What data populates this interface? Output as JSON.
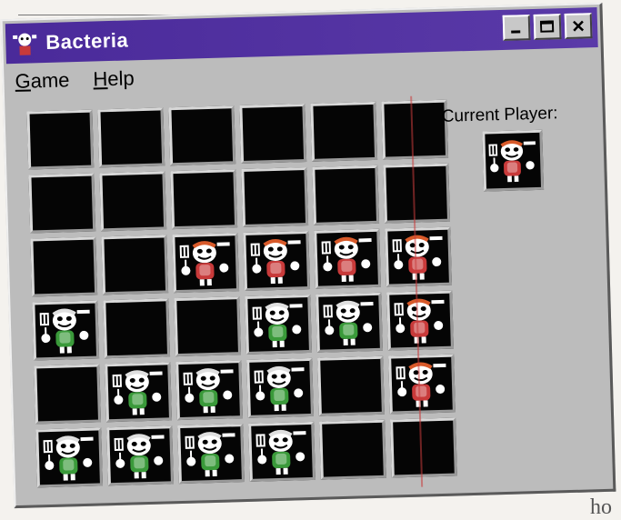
{
  "window": {
    "title": "Bacteria",
    "app_icon": "bacteria-icon",
    "buttons": [
      "minimize",
      "maximize",
      "close"
    ]
  },
  "menu": [
    {
      "label": "Game",
      "mnemonic": "G",
      "rest": "ame"
    },
    {
      "label": "Help",
      "mnemonic": "H",
      "rest": "elp"
    }
  ],
  "status": {
    "label": "Current Player:",
    "current_player": "red"
  },
  "board": {
    "rows": 6,
    "cols": 6,
    "cells": [
      [
        "empty",
        "empty",
        "empty",
        "empty",
        "empty",
        "empty"
      ],
      [
        "empty",
        "empty",
        "empty",
        "empty",
        "empty",
        "empty"
      ],
      [
        "empty",
        "empty",
        "red",
        "red",
        "red",
        "red"
      ],
      [
        "green",
        "empty",
        "empty",
        "green",
        "green",
        "red"
      ],
      [
        "empty",
        "green",
        "green",
        "green",
        "empty",
        "red"
      ],
      [
        "green",
        "green",
        "green",
        "green",
        "empty",
        "empty"
      ]
    ]
  },
  "colors": {
    "titlebar": "#4a2a9a",
    "red_player": "#c83a3a",
    "green_player": "#3a9a3a"
  },
  "background_text": "ho"
}
